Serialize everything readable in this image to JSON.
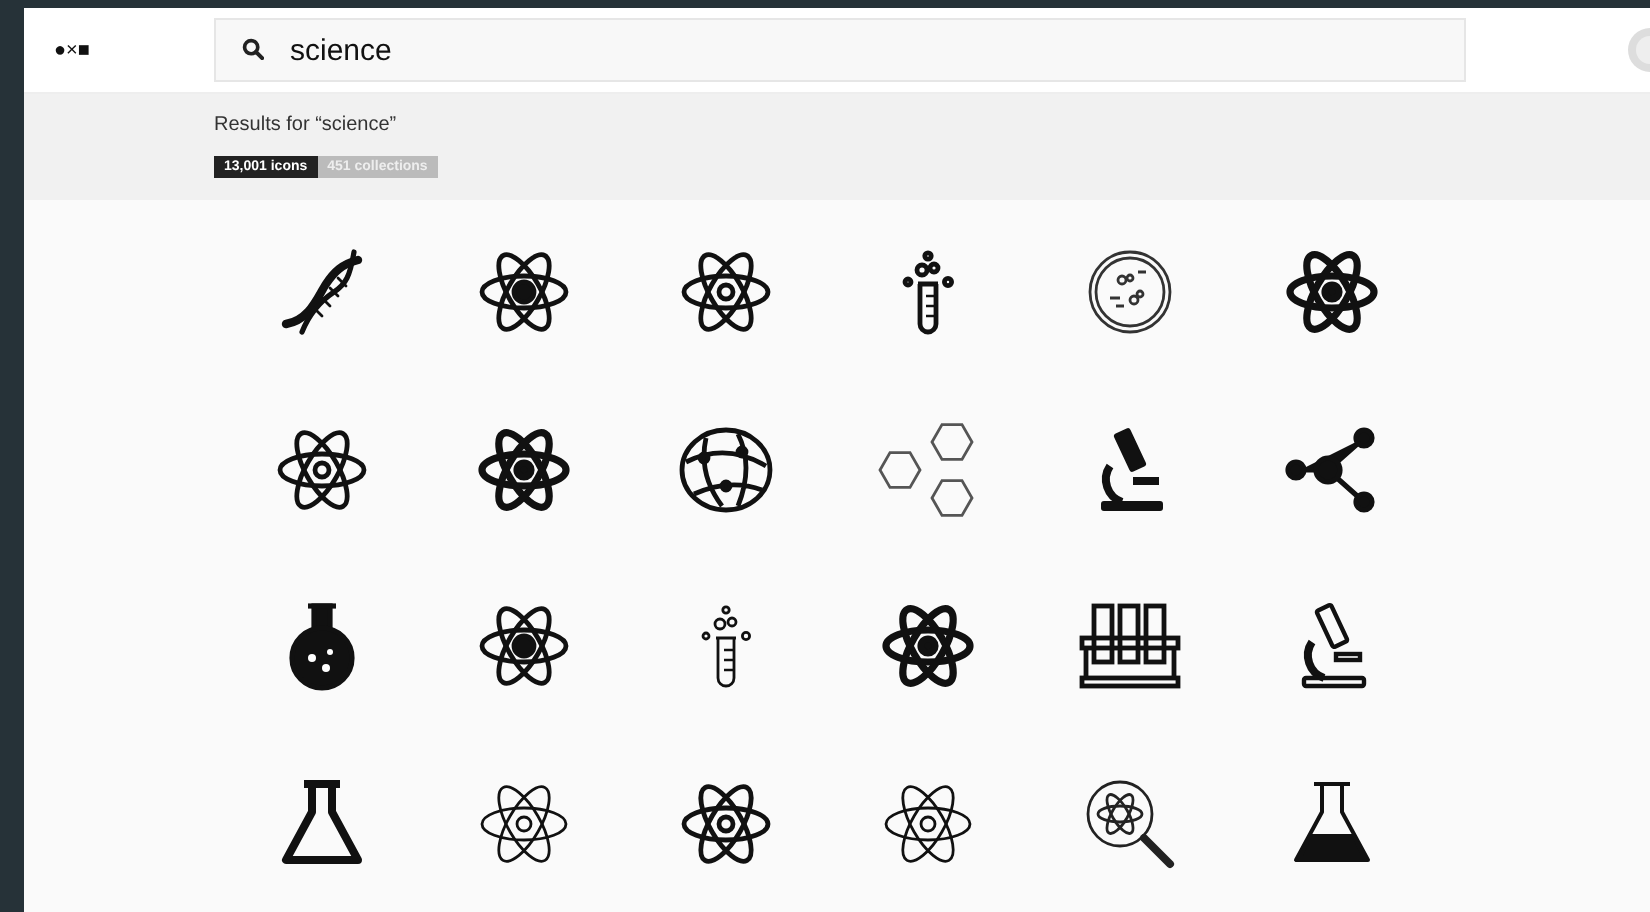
{
  "header": {
    "logo": "●×■",
    "search": {
      "value": "science"
    }
  },
  "results": {
    "heading": "Results for “science”",
    "tabs": [
      {
        "label": "13,001 icons",
        "selected": true
      },
      {
        "label": "451 collections",
        "selected": false
      }
    ]
  },
  "icons": [
    {
      "kind": "dna"
    },
    {
      "kind": "atom"
    },
    {
      "kind": "atom"
    },
    {
      "kind": "test-tube"
    },
    {
      "kind": "petri-dish"
    },
    {
      "kind": "atom"
    },
    {
      "kind": "atom"
    },
    {
      "kind": "atom"
    },
    {
      "kind": "globe"
    },
    {
      "kind": "hexagons"
    },
    {
      "kind": "microscope"
    },
    {
      "kind": "share"
    },
    {
      "kind": "round-flask"
    },
    {
      "kind": "atom"
    },
    {
      "kind": "test-tube"
    },
    {
      "kind": "atom"
    },
    {
      "kind": "test-tube-rack"
    },
    {
      "kind": "microscope"
    },
    {
      "kind": "erlenmeyer-flask"
    },
    {
      "kind": "atom"
    },
    {
      "kind": "atom"
    },
    {
      "kind": "atom"
    },
    {
      "kind": "magnifier"
    },
    {
      "kind": "erlenmeyer-flask"
    }
  ]
}
